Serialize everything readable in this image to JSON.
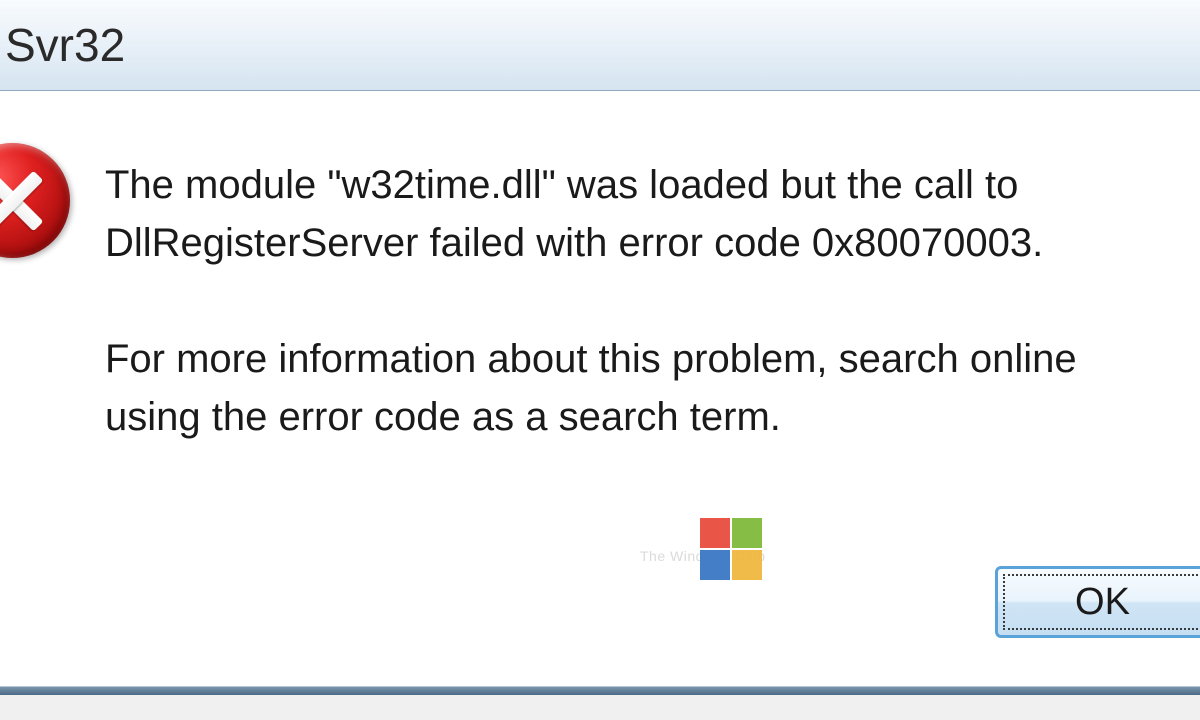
{
  "dialog": {
    "title": "Svr32",
    "message": "The module \"w32time.dll\" was loaded but the call to DllRegisterServer failed with error code 0x80070003.\n\nFor more information about this problem, search online using the error code as a search term.",
    "icon": "error-icon",
    "buttons": {
      "ok": "OK"
    }
  },
  "watermark": {
    "text": "The Windows Club"
  },
  "colors": {
    "titlebar_gradient_top": "#f8fbfd",
    "titlebar_gradient_bottom": "#d5e4f0",
    "error_red": "#e02020",
    "button_border": "#5aa3d8"
  }
}
